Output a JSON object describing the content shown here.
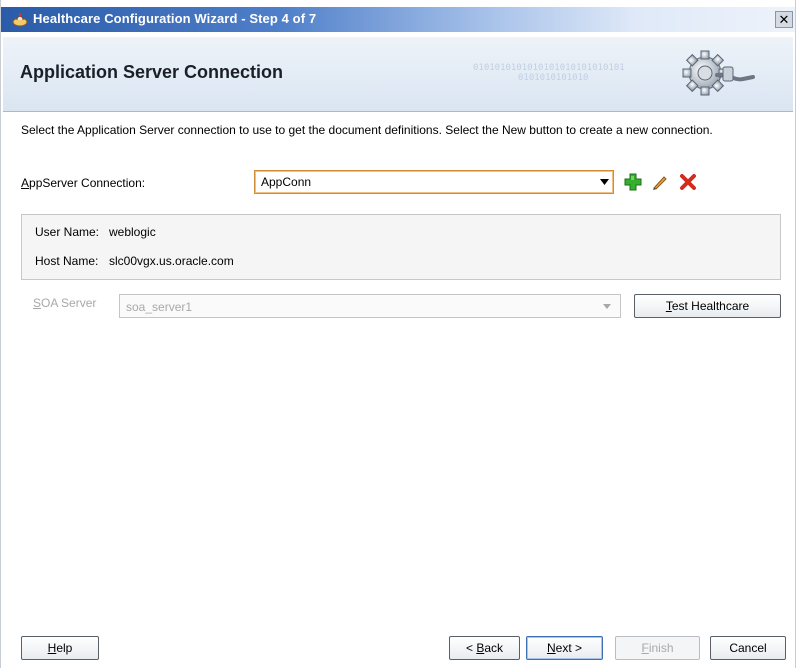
{
  "window": {
    "title": "Healthcare Configuration Wizard - Step 4 of 7",
    "close_symbol": "✕"
  },
  "header": {
    "title": "Application Server Connection",
    "binary_line1": "0101010101010101010101010101",
    "binary_line2": "0101010101010"
  },
  "instructions": "Select the Application Server connection to use to get the document definitions.  Select the New button to create a new connection.",
  "appserver": {
    "label_mnemonic": "A",
    "label_rest": "ppServer Connection:",
    "selected_value": "AppConn",
    "icons": [
      "add-icon",
      "edit-icon",
      "delete-icon"
    ]
  },
  "connection_info": {
    "user_name_label": "User Name:",
    "user_name_value": "weblogic",
    "host_name_label": "Host Name:",
    "host_name_value": "slc00vgx.us.oracle.com"
  },
  "soa": {
    "label_mnemonic": "S",
    "label_rest": "OA Server",
    "selected_value": "soa_server1",
    "test_button_mnemonic": "T",
    "test_button_rest": "est Healthcare"
  },
  "footer": {
    "help_mnemonic": "H",
    "help_rest": "elp",
    "back_prefix": "< ",
    "back_mnemonic": "B",
    "back_rest": "ack",
    "next_mnemonic": "N",
    "next_rest": "ext >",
    "finish_mnemonic": "F",
    "finish_rest": "inish",
    "cancel_label": "Cancel"
  },
  "colors": {
    "accent_add": "#2fa52a",
    "accent_delete": "#d42b1e",
    "titlebar": "#2a5ba8"
  }
}
